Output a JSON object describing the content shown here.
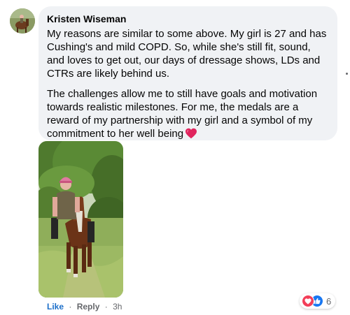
{
  "comment": {
    "author": "Kristen Wiseman",
    "paragraphs": [
      "My reasons are similar to some above. My girl is 27 and has Cushing's and mild COPD. So, while she's still fit, sound, and loves to get out, our days of dressage shows, LDs and CTRs are likely behind us.",
      "The challenges allow me to still have goals and motivation towards realistic milestones. For me, the medals are a reward of my partnership with my girl and a symbol of my commitment to her well being"
    ],
    "emoji_icon": "red-heart-icon",
    "photo_alt": "Woman in pink helmet riding a brown horse on a grassy trail"
  },
  "actions": {
    "like_label": "Like",
    "reply_label": "Reply",
    "separator": "·",
    "time": "3h"
  },
  "reactions": {
    "icons": [
      "love-reaction-icon",
      "like-reaction-icon"
    ],
    "count": "6",
    "colors": {
      "love": "#f33e58",
      "like": "#1877f2"
    }
  },
  "colors": {
    "bubble_bg": "#f0f2f5",
    "meta_text": "#65676b",
    "link_blue": "#1c6fc9"
  }
}
